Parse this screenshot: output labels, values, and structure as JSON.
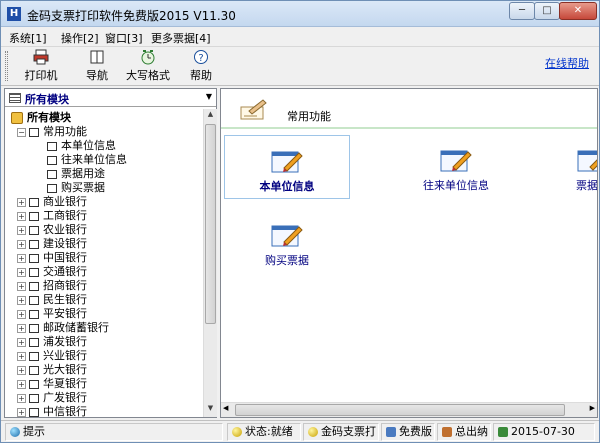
{
  "window": {
    "title": "金码支票打印软件免费版2015  V11.30",
    "app_icon_glyph": "H",
    "buttons": {
      "min": "─",
      "max": "□",
      "close": "✕"
    }
  },
  "menu": [
    "系统[1]",
    "操作[2]",
    "窗口[3]",
    "更多票据[4]"
  ],
  "toolbar": {
    "buttons": [
      {
        "label": "打印机",
        "icon": "printer-icon"
      },
      {
        "label": "导航",
        "icon": "book-icon"
      },
      {
        "label": "大写格式",
        "icon": "clock-icon"
      },
      {
        "label": "帮助",
        "icon": "help-icon"
      }
    ],
    "online_help": "在线帮助"
  },
  "left_panel": {
    "combo_label": "所有模块",
    "tree": {
      "root": "所有模块",
      "common": "常用功能",
      "common_children": [
        "本单位信息",
        "往来单位信息",
        "票据用途",
        "购买票据"
      ],
      "banks": [
        "商业银行",
        "工商银行",
        "农业银行",
        "建设银行",
        "中国银行",
        "交通银行",
        "招商银行",
        "民生银行",
        "平安银行",
        "邮政储蓄银行",
        "浦发银行",
        "兴业银行",
        "光大银行",
        "华夏银行",
        "广发银行",
        "中信银行"
      ]
    }
  },
  "right_panel": {
    "header": "常用功能",
    "modules": [
      "本单位信息",
      "往来单位信息",
      "票据用途",
      "购买票据"
    ],
    "selected_module": "本单位信息"
  },
  "status": {
    "hint": "提示",
    "state": "状态:就绪",
    "product": "金码支票打",
    "edition": "免费版",
    "cashier": "总出纳",
    "date": "2015-07-30"
  },
  "colors": {
    "accent": "#000080",
    "link": "#0033cc",
    "header_rule": "#c8e6c8"
  }
}
